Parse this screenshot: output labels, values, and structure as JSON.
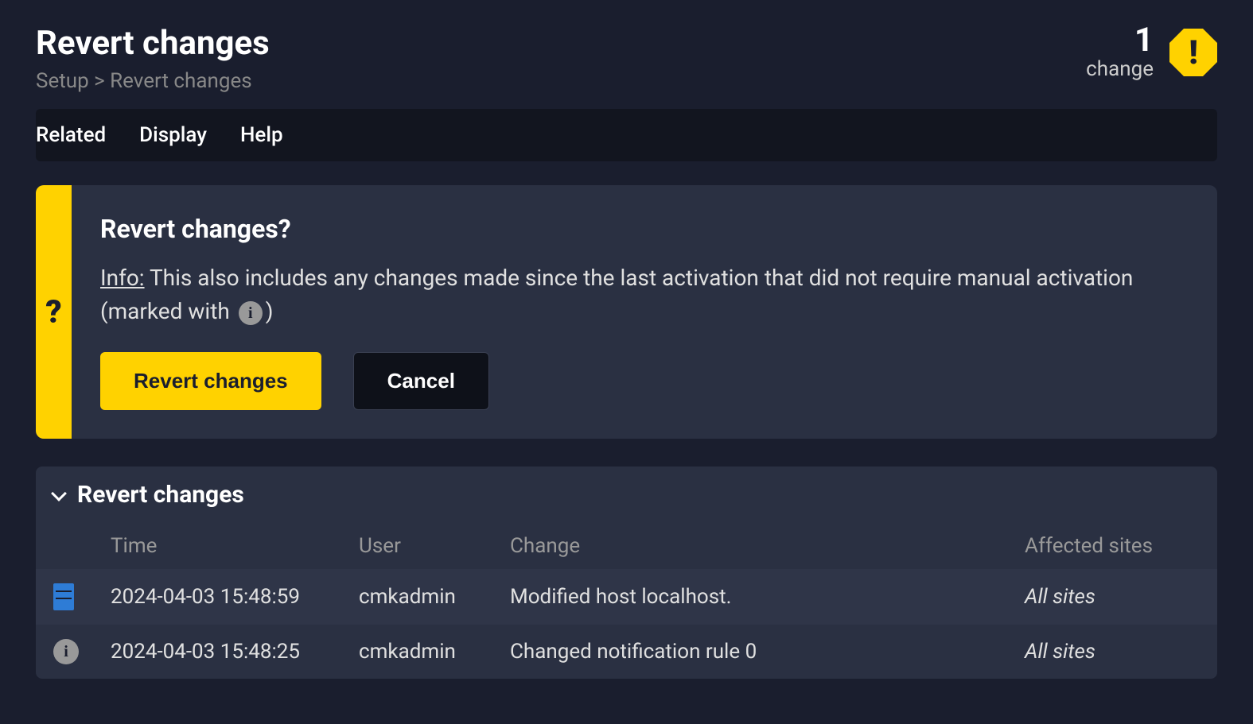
{
  "header": {
    "title": "Revert changes",
    "breadcrumb": "Setup  >  Revert changes",
    "change_count": "1",
    "change_label": "change"
  },
  "menu": {
    "related": "Related",
    "display": "Display",
    "help": "Help"
  },
  "dialog": {
    "title": "Revert changes?",
    "info_label": "Info:",
    "info_text_1": " This also includes any changes made since the last activation that did not require manual activation (marked with ",
    "info_text_2": ")",
    "btn_confirm": "Revert changes",
    "btn_cancel": "Cancel"
  },
  "section": {
    "title": "Revert changes",
    "columns": {
      "time": "Time",
      "user": "User",
      "change": "Change",
      "sites": "Affected sites"
    },
    "rows": [
      {
        "icon": "server",
        "time": "2024-04-03 15:48:59",
        "user": "cmkadmin",
        "change": "Modified host localhost.",
        "sites": "All sites"
      },
      {
        "icon": "info",
        "time": "2024-04-03 15:48:25",
        "user": "cmkadmin",
        "change": "Changed notification rule 0",
        "sites": "All sites"
      }
    ]
  }
}
